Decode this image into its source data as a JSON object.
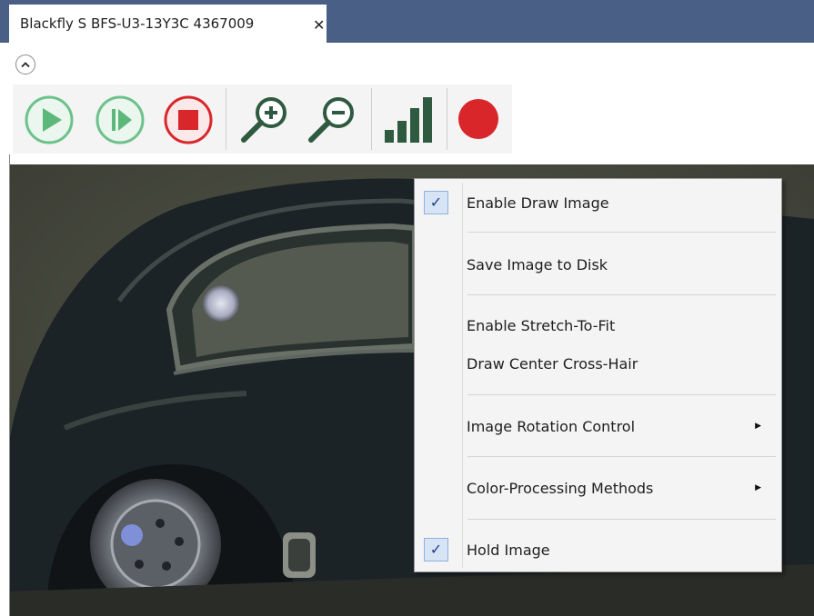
{
  "tab": {
    "title": "Blackfly S BFS-U3-13Y3C 4367009",
    "close_glyph": "✕"
  },
  "toolbar": {
    "buttons": [
      {
        "name": "start-button",
        "icon": "play-icon"
      },
      {
        "name": "single-frame-button",
        "icon": "step-play-icon"
      },
      {
        "name": "stop-button",
        "icon": "stop-icon"
      },
      {
        "name": "zoom-in-button",
        "icon": "zoom-in-icon"
      },
      {
        "name": "zoom-out-button",
        "icon": "zoom-out-icon"
      },
      {
        "name": "histogram-button",
        "icon": "bar-chart-icon"
      },
      {
        "name": "record-button",
        "icon": "record-icon"
      }
    ],
    "colors": {
      "green": "#5cb87a",
      "red": "#d9262b",
      "dark_green": "#2e5a40"
    }
  },
  "context_menu": {
    "items": [
      {
        "label": "Enable Draw Image",
        "checked": true
      },
      {
        "label": "Save Image to Disk"
      },
      {
        "label": "Enable Stretch-To-Fit"
      },
      {
        "label": "Draw Center Cross-Hair"
      },
      {
        "label": "Image Rotation Control",
        "submenu": true
      },
      {
        "label": "Color-Processing Methods",
        "submenu": true
      },
      {
        "label": "Hold Image",
        "checked": true
      }
    ],
    "check_glyph": "✓",
    "submenu_glyph": "▶"
  },
  "colors": {
    "tabbar": "#4a5f86",
    "menu_bg": "#f4f4f4",
    "check_bg": "#d6e4f5"
  }
}
